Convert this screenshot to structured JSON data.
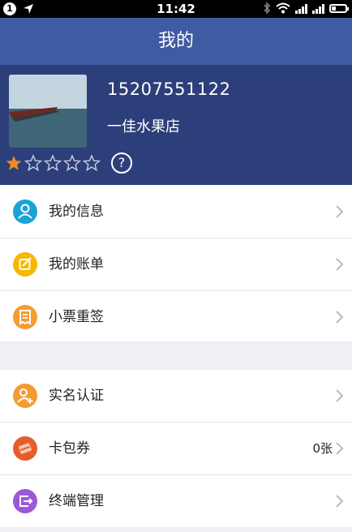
{
  "statusbar": {
    "notification_badge": "1",
    "time": "11:42"
  },
  "header": {
    "title": "我的"
  },
  "profile": {
    "phone": "15207551122",
    "shop_name": "一佳水果店",
    "rating": 1,
    "rating_max": 5,
    "help_label": "?"
  },
  "colors": {
    "nav": "#3f5ba2",
    "profile_bg": "#2d3f7a",
    "star_on": "#f08a24"
  },
  "menu_group_1": [
    {
      "label": "我的信息",
      "icon": "person-icon",
      "color": "#1aa3d6"
    },
    {
      "label": "我的账单",
      "icon": "bill-icon",
      "color": "#f5b800"
    },
    {
      "label": "小票重签",
      "icon": "receipt-icon",
      "color": "#f39c32"
    }
  ],
  "menu_group_2": [
    {
      "label": "实名认证",
      "icon": "verify-icon",
      "color": "#f39c32",
      "value": ""
    },
    {
      "label": "卡包券",
      "icon": "card-icon",
      "color": "#e55d2b",
      "value": "0张"
    },
    {
      "label": "终端管理",
      "icon": "terminal-icon",
      "color": "#9b59d6",
      "value": ""
    }
  ]
}
